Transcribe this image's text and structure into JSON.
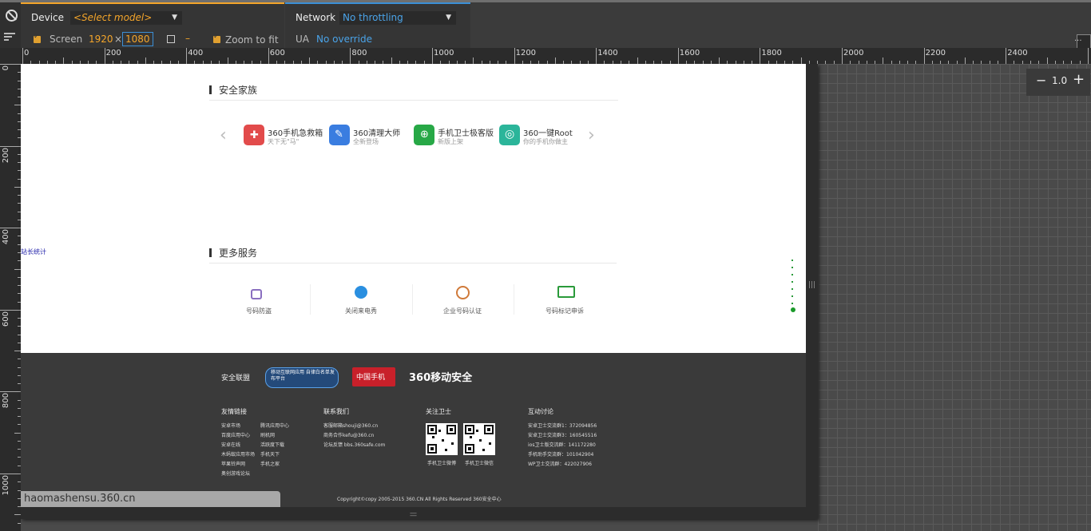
{
  "toolbar": {
    "device_label": "Device",
    "model_select": "<Select model>",
    "screen_label": "Screen",
    "screen_width": "1920",
    "screen_times": "×",
    "screen_height": "1080",
    "swap_dash": "–",
    "zoom_to_fit_label": "Zoom to fit",
    "network_label": "Network",
    "network_select": "No throttling",
    "ua_label": "UA",
    "ua_value": "No override",
    "more_glyph": "..."
  },
  "ruler": {
    "top_marks": [
      "0",
      "200",
      "400",
      "600",
      "800",
      "1000",
      "1200",
      "1400",
      "1600",
      "1800",
      "2000",
      "2200",
      "2400"
    ],
    "left_marks": [
      "0",
      "200",
      "400",
      "600",
      "800",
      "1000"
    ]
  },
  "zoom": {
    "minus": "−",
    "value": "1.0",
    "plus": "+"
  },
  "site": {
    "stats_link": "站长统计",
    "family_title": "安全家族",
    "apps": [
      {
        "name": "360手机急救箱",
        "sub": "天下无\"马\"",
        "color": "#e24b4b"
      },
      {
        "name": "360清理大师",
        "sub": "全新登场",
        "color": "#3a7de0"
      },
      {
        "name": "手机卫士极客版",
        "sub": "新版上架",
        "color": "#27a846"
      },
      {
        "name": "360一键Root",
        "sub": "你的手机你做主",
        "color": "#2bb59a"
      }
    ],
    "services_title": "更多服务",
    "services": [
      {
        "label": "号码防盗",
        "color": "#8a6fc0"
      },
      {
        "label": "关闭来电秀",
        "color": "#2a8fe0"
      },
      {
        "label": "企业号码认证",
        "color": "#d07a3a"
      },
      {
        "label": "号码标记申诉",
        "color": "#2a9a3a"
      }
    ]
  },
  "footer": {
    "alliance_label": "安全联盟",
    "alliance_badge1": "移动互联网应用 自律白名单发布平台",
    "alliance_badge2": "中国手机",
    "alliance_badge3": "360移动安全",
    "friends_title": "友情链接",
    "friends_col1": [
      "安卓市场",
      "百度应用中心",
      "安卓在线",
      "木蚂蚁应用市场",
      "苹果铃声网",
      "奥创游戏论坛"
    ],
    "friends_col2": [
      "腾讯应用中心",
      "刷机网",
      "活跃度下载",
      "手机天下",
      "手机之家"
    ],
    "contact_title": "联系我们",
    "contact_items": [
      "客服邮箱shouji@360.cn",
      "商务合作kefu@360.cn",
      "论坛反馈 bbs.360safe.com"
    ],
    "follow_title": "关注卫士",
    "qr_labels": [
      "手机卫士微博",
      "手机卫士微信"
    ],
    "discuss_title": "互动讨论",
    "discuss_items": [
      "安卓卫士交流群1：372094856",
      "安卓卫士交流群3：160545516",
      "ios卫士版交流群：141172280",
      "手机助手交流群：101042904",
      "WP卫士交流群：422027906"
    ],
    "copyright": "Copyright©copy 2005-2015 360.CN All Rights Reserved 360安全中心",
    "url": "haomashensu.360.cn"
  }
}
